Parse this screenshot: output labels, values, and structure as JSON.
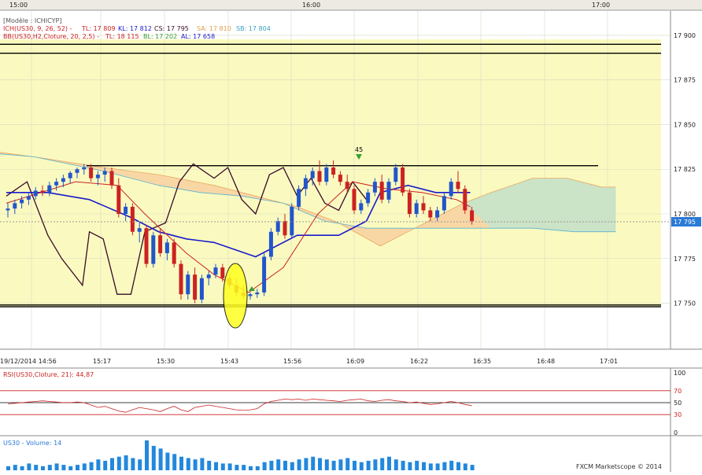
{
  "top_axis": {
    "times": [
      "15:00",
      "16:00",
      "17:00"
    ]
  },
  "info": {
    "model_label": "[Modèle : ICHICYP]",
    "ich_name": "ICH(US30, 9, 26, 52) -",
    "ich_tl": "TL: 17 809",
    "ich_kl": "KL: 17 812",
    "ich_cs": "CS: 17 795",
    "ich_sa": "SA: 17 810",
    "ich_sb": "SB: 17 804",
    "bb_name": "BB(US30,H2,Cloture, 20, 2,5) -",
    "bb_tl": "TL: 18 115",
    "bb_bl": "BL: 17 202",
    "bb_al": "AL: 17 658"
  },
  "annotation_45": "45",
  "current_price_label": "17 795",
  "rsi": {
    "label": "RSI(US30,Cloture, 21): 44,87",
    "ticks": [
      "100",
      "70",
      "50",
      "30",
      "0"
    ]
  },
  "volume": {
    "label": "US30 - Volume: 14",
    "footer": "FXCM Marketscope © 2014"
  },
  "colors": {
    "background_zone": "#fafac0",
    "bull_candle": "#2255cc",
    "bear_candle": "#cc2222",
    "tenkan": "#cc2222",
    "kijun": "#1a1acc",
    "chikou": "#3a0a2a",
    "cloud_bear": "#f8d0a0",
    "cloud_bull": "#c8e4c8",
    "volume_bar": "#2288dd"
  },
  "chart_data": {
    "type": "candlestick",
    "y_ticks": [
      "17 900",
      "17 875",
      "17 850",
      "17 825",
      "17 800",
      "17 775",
      "17 750"
    ],
    "ylim": [
      17726,
      17911
    ],
    "x_ticks": [
      "19/12/2014 14:56",
      "15:17",
      "15:30",
      "15:43",
      "15:56",
      "16:09",
      "16:22",
      "16:35",
      "16:48",
      "17:01"
    ],
    "horizontal_levels": [
      17895,
      17890,
      17827,
      17749,
      17748
    ],
    "candles": [
      [
        17802,
        17806,
        17798,
        17803
      ],
      [
        17803,
        17808,
        17800,
        17806
      ],
      [
        17806,
        17810,
        17803,
        17808
      ],
      [
        17808,
        17812,
        17805,
        17810
      ],
      [
        17810,
        17815,
        17808,
        17813
      ],
      [
        17813,
        17816,
        17810,
        17812
      ],
      [
        17812,
        17818,
        17810,
        17816
      ],
      [
        17816,
        17820,
        17813,
        17818
      ],
      [
        17818,
        17822,
        17815,
        17820
      ],
      [
        17820,
        17824,
        17817,
        17823
      ],
      [
        17823,
        17826,
        17820,
        17825
      ],
      [
        17825,
        17828,
        17822,
        17826
      ],
      [
        17826,
        17828,
        17818,
        17820
      ],
      [
        17820,
        17824,
        17816,
        17822
      ],
      [
        17822,
        17826,
        17818,
        17824
      ],
      [
        17824,
        17826,
        17814,
        17816
      ],
      [
        17816,
        17820,
        17798,
        17800
      ],
      [
        17800,
        17806,
        17796,
        17804
      ],
      [
        17804,
        17806,
        17788,
        17790
      ],
      [
        17790,
        17796,
        17784,
        17792
      ],
      [
        17792,
        17794,
        17770,
        17772
      ],
      [
        17772,
        17790,
        17770,
        17788
      ],
      [
        17788,
        17792,
        17776,
        17778
      ],
      [
        17778,
        17786,
        17774,
        17784
      ],
      [
        17784,
        17786,
        17770,
        17772
      ],
      [
        17772,
        17774,
        17752,
        17755
      ],
      [
        17755,
        17768,
        17752,
        17766
      ],
      [
        17766,
        17770,
        17750,
        17752
      ],
      [
        17752,
        17766,
        17750,
        17764
      ],
      [
        17764,
        17768,
        17760,
        17766
      ],
      [
        17766,
        17772,
        17764,
        17770
      ],
      [
        17770,
        17772,
        17762,
        17764
      ],
      [
        17764,
        17766,
        17758,
        17760
      ],
      [
        17760,
        17764,
        17754,
        17756
      ],
      [
        17756,
        17760,
        17752,
        17754
      ],
      [
        17754,
        17756,
        17752,
        17755
      ],
      [
        17755,
        17758,
        17753,
        17756
      ],
      [
        17756,
        17778,
        17754,
        17776
      ],
      [
        17776,
        17792,
        17774,
        17790
      ],
      [
        17790,
        17798,
        17788,
        17796
      ],
      [
        17796,
        17800,
        17786,
        17788
      ],
      [
        17788,
        17806,
        17786,
        17804
      ],
      [
        17804,
        17816,
        17802,
        17814
      ],
      [
        17814,
        17822,
        17810,
        17820
      ],
      [
        17820,
        17826,
        17816,
        17824
      ],
      [
        17824,
        17830,
        17816,
        17818
      ],
      [
        17818,
        17828,
        17816,
        17826
      ],
      [
        17826,
        17830,
        17820,
        17822
      ],
      [
        17822,
        17824,
        17816,
        17818
      ],
      [
        17818,
        17822,
        17812,
        17814
      ],
      [
        17814,
        17816,
        17800,
        17802
      ],
      [
        17802,
        17808,
        17800,
        17806
      ],
      [
        17806,
        17814,
        17804,
        17812
      ],
      [
        17812,
        17820,
        17810,
        17818
      ],
      [
        17818,
        17822,
        17806,
        17808
      ],
      [
        17808,
        17820,
        17806,
        17818
      ],
      [
        17818,
        17828,
        17816,
        17826
      ],
      [
        17826,
        17828,
        17810,
        17812
      ],
      [
        17812,
        17814,
        17798,
        17800
      ],
      [
        17800,
        17808,
        17798,
        17806
      ],
      [
        17806,
        17810,
        17800,
        17802
      ],
      [
        17802,
        17804,
        17796,
        17798
      ],
      [
        17798,
        17804,
        17796,
        17802
      ],
      [
        17802,
        17812,
        17800,
        17810
      ],
      [
        17810,
        17820,
        17808,
        17818
      ],
      [
        17818,
        17824,
        17812,
        17814
      ],
      [
        17814,
        17816,
        17800,
        17802
      ],
      [
        17802,
        17804,
        17794,
        17796
      ]
    ],
    "tenkan": [
      [
        0,
        17806
      ],
      [
        10,
        17818
      ],
      [
        16,
        17816
      ],
      [
        20,
        17800
      ],
      [
        26,
        17778
      ],
      [
        30,
        17766
      ],
      [
        35,
        17756
      ],
      [
        40,
        17770
      ],
      [
        45,
        17800
      ],
      [
        50,
        17818
      ],
      [
        55,
        17814
      ],
      [
        60,
        17812
      ],
      [
        65,
        17808
      ],
      [
        67,
        17804
      ]
    ],
    "kijun": [
      [
        0,
        17812
      ],
      [
        6,
        17812
      ],
      [
        12,
        17808
      ],
      [
        18,
        17798
      ],
      [
        22,
        17790
      ],
      [
        26,
        17786
      ],
      [
        30,
        17784
      ],
      [
        36,
        17776
      ],
      [
        42,
        17788
      ],
      [
        48,
        17788
      ],
      [
        52,
        17796
      ],
      [
        54,
        17812
      ],
      [
        58,
        17816
      ],
      [
        62,
        17812
      ],
      [
        67,
        17812
      ]
    ],
    "chikou": [
      [
        0,
        17810
      ],
      [
        3,
        17818
      ],
      [
        6,
        17788
      ],
      [
        8,
        17775
      ],
      [
        11,
        17760
      ],
      [
        12,
        17790
      ],
      [
        14,
        17786
      ],
      [
        16,
        17755
      ],
      [
        18,
        17755
      ],
      [
        20,
        17790
      ],
      [
        23,
        17795
      ],
      [
        25,
        17818
      ],
      [
        27,
        17828
      ],
      [
        30,
        17820
      ],
      [
        32,
        17826
      ],
      [
        34,
        17808
      ],
      [
        36,
        17800
      ],
      [
        38,
        17822
      ],
      [
        40,
        17826
      ],
      [
        42,
        17810
      ],
      [
        44,
        17820
      ],
      [
        46,
        17806
      ],
      [
        48,
        17802
      ],
      [
        50,
        17818
      ],
      [
        52,
        17808
      ]
    ],
    "cloud_a": [
      [
        -8,
        17838
      ],
      [
        4,
        17832
      ],
      [
        14,
        17826
      ],
      [
        22,
        17822
      ],
      [
        30,
        17816
      ],
      [
        36,
        17810
      ],
      [
        42,
        17804
      ],
      [
        48,
        17795
      ],
      [
        54,
        17782
      ],
      [
        58,
        17790
      ],
      [
        62,
        17798
      ],
      [
        66,
        17806
      ],
      [
        70,
        17812
      ],
      [
        76,
        17820
      ],
      [
        81,
        17820
      ],
      [
        86,
        17815
      ],
      [
        88,
        17815
      ]
    ],
    "cloud_b": [
      [
        -8,
        17836
      ],
      [
        4,
        17832
      ],
      [
        14,
        17824
      ],
      [
        22,
        17816
      ],
      [
        28,
        17812
      ],
      [
        34,
        17810
      ],
      [
        40,
        17806
      ],
      [
        46,
        17796
      ],
      [
        52,
        17792
      ],
      [
        58,
        17792
      ],
      [
        64,
        17792
      ],
      [
        70,
        17792
      ],
      [
        76,
        17792
      ],
      [
        82,
        17790
      ],
      [
        88,
        17790
      ]
    ],
    "rsi": [
      48,
      49,
      50,
      51,
      52,
      53,
      52,
      51,
      50,
      50,
      51,
      50,
      46,
      42,
      44,
      40,
      36,
      34,
      38,
      42,
      40,
      38,
      35,
      40,
      44,
      38,
      35,
      42,
      44,
      46,
      44,
      42,
      40,
      38,
      37,
      38,
      40,
      48,
      52,
      54,
      56,
      55,
      56,
      54,
      56,
      55,
      54,
      53,
      52,
      54,
      55,
      56,
      53,
      52,
      54,
      55,
      53,
      52,
      50,
      51,
      49,
      47,
      48,
      50,
      52,
      50,
      47,
      45
    ],
    "volume": [
      3,
      4,
      3,
      5,
      4,
      3,
      4,
      5,
      4,
      3,
      4,
      5,
      6,
      8,
      7,
      9,
      10,
      11,
      9,
      8,
      22,
      18,
      16,
      13,
      12,
      10,
      9,
      8,
      9,
      7,
      6,
      5,
      5,
      4,
      4,
      3,
      3,
      6,
      7,
      8,
      7,
      6,
      8,
      9,
      10,
      9,
      8,
      7,
      8,
      9,
      7,
      6,
      7,
      8,
      9,
      10,
      8,
      7,
      6,
      7,
      6,
      5,
      5,
      6,
      7,
      6,
      5,
      4
    ]
  }
}
